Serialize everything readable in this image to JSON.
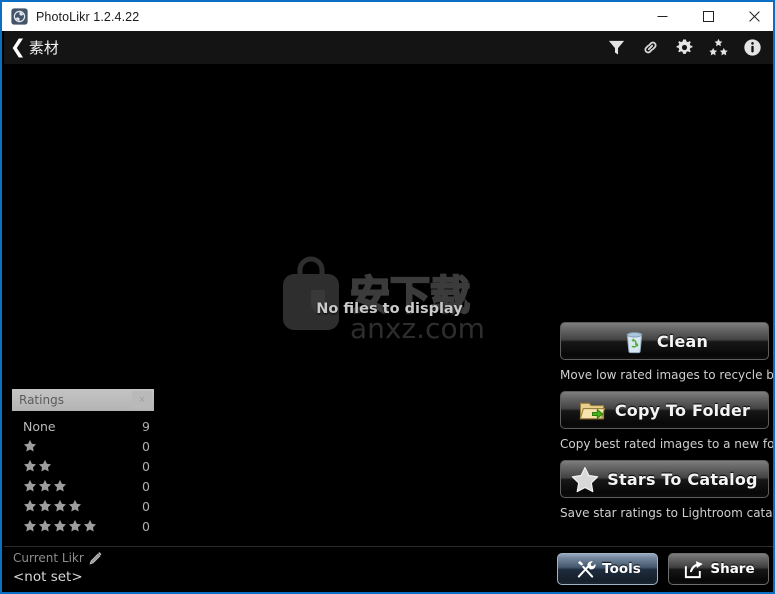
{
  "window": {
    "title": "PhotoLikr 1.2.4.22",
    "app_icon": "aperture-icon",
    "accent_color": "#0b6fc4",
    "controls": {
      "minimize": "minimize-icon",
      "maximize": "maximize-icon",
      "close": "close-icon"
    }
  },
  "toolbar": {
    "back_chevron": "❮",
    "breadcrumb_label": "素材",
    "icons": [
      {
        "name": "filter-icon",
        "title": "Filter"
      },
      {
        "name": "link-icon",
        "title": "Link"
      },
      {
        "name": "gear-icon",
        "title": "Settings"
      },
      {
        "name": "stars-icon",
        "title": "Ratings"
      },
      {
        "name": "info-icon",
        "title": "Info"
      }
    ]
  },
  "canvas": {
    "empty_message": "No files to display",
    "watermark_text": "anxz.com",
    "watermark_cjk": "安下载"
  },
  "ratings": {
    "title": "Ratings",
    "close_label": "×",
    "rows": [
      {
        "label": "None",
        "stars": 0,
        "count": "9"
      },
      {
        "label": "",
        "stars": 1,
        "count": "0"
      },
      {
        "label": "",
        "stars": 2,
        "count": "0"
      },
      {
        "label": "",
        "stars": 3,
        "count": "0"
      },
      {
        "label": "",
        "stars": 4,
        "count": "0"
      },
      {
        "label": "",
        "stars": 5,
        "count": "0"
      }
    ]
  },
  "actions": [
    {
      "label": "Clean",
      "icon": "recycle-bin-icon",
      "description": "Move low rated images to recycle bin"
    },
    {
      "label": "Copy To Folder",
      "icon": "folder-arrow-icon",
      "description": "Copy best rated images to a new folder"
    },
    {
      "label": "Stars To Catalog",
      "icon": "star-icon",
      "description": "Save star ratings to Lightroom catalog"
    }
  ],
  "status": {
    "current_likr_label": "Current Likr",
    "edit_icon": "pencil-icon",
    "current_likr_value": "<not set>"
  },
  "bottom_buttons": [
    {
      "label": "Tools",
      "icon": "tools-icon",
      "id": "tools-button"
    },
    {
      "label": "Share",
      "icon": "share-icon",
      "id": "share-button"
    }
  ]
}
